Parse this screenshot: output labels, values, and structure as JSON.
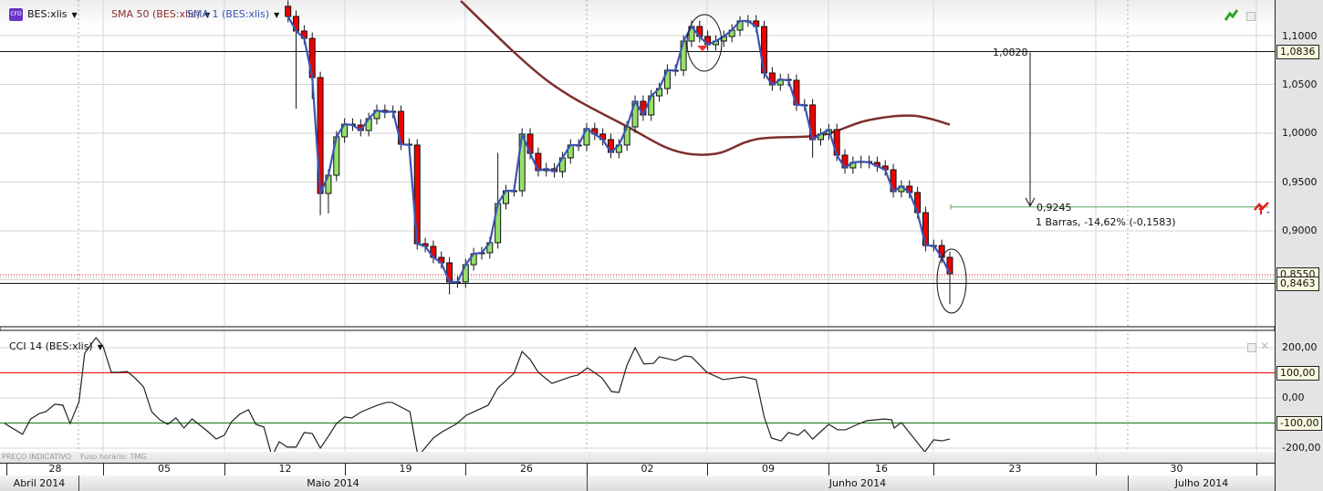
{
  "header": {
    "badge": "CFD",
    "symbol": "BES:xlis",
    "indicators": [
      {
        "label": "SMA 50 (BES:xlis)",
        "color": "#8a3030"
      },
      {
        "label": "SMA 1 (BES:xlis)",
        "color": "#3b55b5"
      }
    ]
  },
  "price_axis": {
    "ticks": [
      "1,1000",
      "1,0500",
      "1,0000",
      "0,9500",
      "0,9000"
    ],
    "markers": {
      "upper_line": "1,0836",
      "dotted_line": "0,8550",
      "lower_line": "0,8463"
    }
  },
  "measure": {
    "start_label": "1,0828",
    "end_label": "0,9245",
    "summary": "1 Barras, -14,62% (-0,1583)"
  },
  "cci_panel": {
    "title": "CCI 14 (BES:xlis)",
    "ticks": [
      "200,00",
      "0,00",
      "-200,00"
    ],
    "markers": {
      "upper": "100,00",
      "lower": "-100,00"
    }
  },
  "footer": {
    "note1": "PREÇO INDICATIVO",
    "note2": "Fuso horário: TMG"
  },
  "time_axis": {
    "days": [
      "28",
      "05",
      "12",
      "19",
      "26",
      "02",
      "09",
      "16",
      "23",
      "30"
    ],
    "months": [
      "Abril 2014",
      "Maio 2014",
      "Junho 2014",
      "Julho 2014"
    ]
  },
  "colors": {
    "up": "#95e06a",
    "down": "#ee0000",
    "sma1": "#3b55b5",
    "sma50": "#7d2e2e",
    "cci": "#222222",
    "overbought": "#ee0000",
    "oversold": "#117711",
    "measure": "#5aa55a"
  },
  "chart_data": [
    {
      "type": "candlestick",
      "title": "BES:xlis",
      "ylim": [
        0.79,
        1.135
      ],
      "first_open": 1.13,
      "closes": [
        1.1196,
        1.1047,
        1.0972,
        1.057,
        0.9383,
        0.957,
        0.9963,
        1.0093,
        1.0084,
        1.0028,
        1.015,
        1.0234,
        1.0215,
        1.0224,
        0.9888,
        0.9879,
        0.8869,
        0.8841,
        0.8729,
        0.8673,
        0.8477,
        0.8477,
        0.8654,
        0.8766,
        0.8776,
        0.8879,
        0.928,
        0.9411,
        0.9411,
        0.9991,
        0.9794,
        0.9617,
        0.9636,
        0.9607,
        0.9748,
        0.9879,
        0.9879,
        1.0047,
        0.9991,
        0.9935,
        0.9804,
        0.9879,
        1.0065,
        1.0327,
        1.0187,
        1.0383,
        1.0458,
        1.0645,
        1.0645,
        1.0944,
        1.1093,
        1.0991,
        1.0907,
        1.0944,
        1.0991,
        1.1056,
        1.115,
        1.115,
        1.1093,
        1.0617,
        1.0495,
        1.0551,
        1.0542,
        1.029,
        1.029,
        0.9935,
        0.9991,
        1.0037,
        0.9776,
        0.9645,
        0.9701,
        0.971,
        0.9701,
        0.9664,
        0.9626,
        0.9402,
        0.9458,
        0.9393,
        0.9187,
        0.885,
        0.885,
        0.8729,
        0.8561
      ],
      "wick_default": 0.006,
      "extremes": [
        {
          "bar": 1,
          "low": 1.025
        },
        {
          "bar": 3,
          "low": 1.035
        },
        {
          "bar": 4,
          "low": 0.916
        },
        {
          "bar": 5,
          "low": 0.918
        },
        {
          "bar": 20,
          "low": 0.835
        },
        {
          "bar": 26,
          "high": 0.98
        },
        {
          "bar": 56,
          "high": 1.12
        },
        {
          "bar": 65,
          "low": 0.975
        },
        {
          "bar": 82,
          "low": 0.825
        }
      ],
      "sma50": [
        [
          21.4,
          1.1355
        ],
        [
          32.1,
          1.054
        ],
        [
          42.3,
          1.0056
        ],
        [
          48,
          0.982
        ],
        [
          53,
          0.979
        ],
        [
          58.1,
          0.994
        ],
        [
          66,
          0.998
        ],
        [
          71.7,
          1.013
        ],
        [
          77.4,
          1.018
        ],
        [
          82,
          1.009
        ]
      ],
      "levels": {
        "upper_line": 1.0836,
        "dotted_line": 0.855,
        "lower_line": 0.8463,
        "measure_start": 1.0828,
        "measure_end": 0.9245
      }
    },
    {
      "type": "line",
      "title": "CCI 14 (BES:xlis)",
      "ylim": [
        -250,
        250
      ],
      "levels": [
        100,
        -100
      ],
      "points": [
        [
          -35.1,
          -102
        ],
        [
          -32.9,
          -145
        ],
        [
          -31.9,
          -84
        ],
        [
          -30.8,
          -62
        ],
        [
          -30,
          -55
        ],
        [
          -28.9,
          -25
        ],
        [
          -27.9,
          -29
        ],
        [
          -27,
          -102
        ],
        [
          -25.9,
          -15
        ],
        [
          -25.2,
          178
        ],
        [
          -23.8,
          240
        ],
        [
          -22.9,
          204
        ],
        [
          -21.9,
          102
        ],
        [
          -21,
          102
        ],
        [
          -19.9,
          105
        ],
        [
          -19,
          80
        ],
        [
          -17.9,
          44
        ],
        [
          -16.9,
          -55
        ],
        [
          -15.9,
          -87
        ],
        [
          -14.9,
          -105
        ],
        [
          -13.9,
          -80
        ],
        [
          -12.9,
          -120
        ],
        [
          -11.9,
          -84
        ],
        [
          -10.9,
          -109
        ],
        [
          -9.9,
          -135
        ],
        [
          -8.9,
          -164
        ],
        [
          -7.9,
          -149
        ],
        [
          -7,
          -95
        ],
        [
          -6,
          -65
        ],
        [
          -4.9,
          -47
        ],
        [
          -4,
          -105
        ],
        [
          -3,
          -116
        ],
        [
          -2,
          -233
        ],
        [
          -1.1,
          -175
        ],
        [
          -0.1,
          -196
        ],
        [
          1,
          -196
        ],
        [
          2,
          -138
        ],
        [
          3,
          -142
        ],
        [
          4,
          -200
        ],
        [
          5,
          -153
        ],
        [
          6,
          -102
        ],
        [
          7,
          -76
        ],
        [
          7.9,
          -80
        ],
        [
          9.1,
          -55
        ],
        [
          11.1,
          -29
        ],
        [
          12.2,
          -18
        ],
        [
          12.9,
          -18
        ],
        [
          15.1,
          -55
        ],
        [
          16.1,
          -233
        ],
        [
          18,
          -160
        ],
        [
          19.1,
          -135
        ],
        [
          20.8,
          -105
        ],
        [
          22.1,
          -69
        ],
        [
          24.8,
          -29
        ],
        [
          26,
          40
        ],
        [
          28,
          98
        ],
        [
          29,
          185
        ],
        [
          30,
          153
        ],
        [
          31,
          102
        ],
        [
          32.7,
          58
        ],
        [
          35,
          84
        ],
        [
          35.9,
          91
        ],
        [
          37.1,
          120
        ],
        [
          38.9,
          80
        ],
        [
          40.1,
          25
        ],
        [
          41,
          22
        ],
        [
          42,
          131
        ],
        [
          43,
          200
        ],
        [
          44.1,
          135
        ],
        [
          45.3,
          138
        ],
        [
          46,
          164
        ],
        [
          48,
          149
        ],
        [
          49.1,
          167
        ],
        [
          50,
          164
        ],
        [
          51.9,
          102
        ],
        [
          53.9,
          73
        ],
        [
          56.4,
          84
        ],
        [
          58,
          73
        ],
        [
          59,
          -76
        ],
        [
          59.9,
          -160
        ],
        [
          61.1,
          -171
        ],
        [
          62,
          -138
        ],
        [
          63.2,
          -149
        ],
        [
          64,
          -127
        ],
        [
          65,
          -164
        ],
        [
          67,
          -105
        ],
        [
          68.1,
          -127
        ],
        [
          69.1,
          -127
        ],
        [
          70.6,
          -105
        ],
        [
          71.7,
          -91
        ],
        [
          73.8,
          -84
        ],
        [
          74.8,
          -87
        ],
        [
          75.1,
          -120
        ],
        [
          76,
          -98
        ],
        [
          78.9,
          -215
        ],
        [
          80,
          -167
        ],
        [
          81,
          -171
        ],
        [
          82,
          -164
        ]
      ]
    }
  ]
}
